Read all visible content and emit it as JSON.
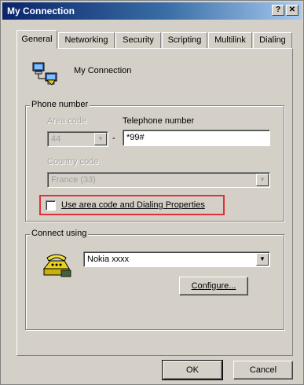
{
  "window": {
    "title": "My Connection",
    "help_glyph": "?",
    "close_glyph": "✕"
  },
  "tabs": [
    {
      "label": "General",
      "active": true
    },
    {
      "label": "Networking",
      "active": false
    },
    {
      "label": "Security",
      "active": false
    },
    {
      "label": "Scripting",
      "active": false
    },
    {
      "label": "Multilink",
      "active": false
    },
    {
      "label": "Dialing",
      "active": false
    }
  ],
  "connection": {
    "name": "My Connection",
    "icon": "network-computers-icon"
  },
  "phone_number": {
    "group_label": "Phone number",
    "area_code_label": "Area code",
    "area_code_value": "44",
    "dash": "-",
    "telephone_label": "Telephone number",
    "telephone_value": "*99#",
    "country_label": "Country code",
    "country_value": "France (33)",
    "use_dialing_label": "Use area code and Dialing Properties",
    "use_dialing_checked": false
  },
  "connect_using": {
    "group_label": "Connect using",
    "device_value": "Nokia xxxx",
    "device_icon": "modem-phone-icon",
    "configure_label": "Configure..."
  },
  "footer": {
    "ok_label": "OK",
    "cancel_label": "Cancel"
  },
  "colors": {
    "titlebar_start": "#0a246a",
    "titlebar_end": "#a6caf0",
    "highlight": "#e0303a",
    "face": "#d4d0c8"
  }
}
